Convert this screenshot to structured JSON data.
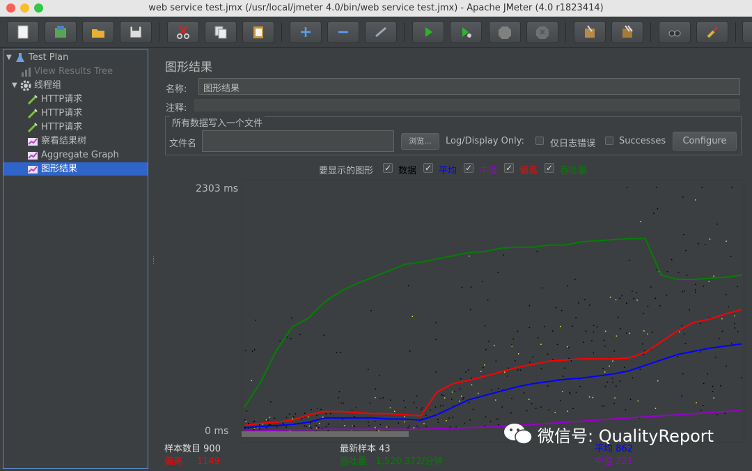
{
  "window": {
    "title": "web service test.jmx (/usr/local/jmeter 4.0/bin/web service test.jmx) - Apache JMeter (4.0 r1823414)"
  },
  "toolbar": {
    "buttons": [
      "new-icon",
      "templates-icon",
      "open-icon",
      "save-icon",
      "cut-icon",
      "copy-icon",
      "paste-icon",
      "expand-icon",
      "collapse-icon",
      "toggle-icon",
      "start-icon",
      "start-no-pause-icon",
      "stop-icon",
      "shutdown-icon",
      "clear-icon",
      "clear-all-icon",
      "search-icon",
      "reset-search-icon"
    ]
  },
  "tree": {
    "test_plan": "Test Plan",
    "view_results_tree": "View Results Tree",
    "thread_group": "线程组",
    "http1": "HTTP请求",
    "http2": "HTTP请求",
    "http3": "HTTP请求",
    "results_tree_cn": "察看结果树",
    "aggregate_graph": "Aggregate Graph",
    "graph_results": "图形结果"
  },
  "panel": {
    "title": "图形结果",
    "name_label": "名称:",
    "name_value": "图形结果",
    "comment_label": "注释:",
    "comment_value": "",
    "file_section": "所有数据写入一个文件",
    "filename_label": "文件名",
    "filename_value": "",
    "browse_label": "浏览...",
    "log_display_label": "Log/Display Only:",
    "errors_only_label": "仅日志错误",
    "successes_label": "Successes",
    "configure_label": "Configure",
    "show_label": "要显示的图形",
    "show_data": "数据",
    "show_average": "平均",
    "show_median": "中值",
    "show_deviation": "偏离",
    "show_throughput": "吞吐量",
    "colors": {
      "average": "#0000ff",
      "median": "#9900cc",
      "deviation": "#ff0000",
      "throughput": "#008000",
      "data": "#000000"
    }
  },
  "chart_data": {
    "type": "line",
    "ymax_label": "2303",
    "ymin_label": "0",
    "yunit": "ms",
    "ylim": [
      0,
      2303
    ],
    "series": [
      {
        "name": "吞吐量",
        "values": [
          250,
          480,
          780,
          1000,
          1080,
          1230,
          1330,
          1400,
          1460,
          1520,
          1580,
          1600,
          1630,
          1660,
          1690,
          1700,
          1730,
          1740,
          1740,
          1760,
          1760,
          1790,
          1800,
          1810,
          1820,
          1820,
          1480,
          1440,
          1440,
          1450,
          1460,
          1480
        ]
      },
      {
        "name": "偏离",
        "values": [
          80,
          100,
          110,
          130,
          180,
          210,
          210,
          200,
          190,
          190,
          180,
          170,
          390,
          470,
          500,
          540,
          580,
          620,
          650,
          680,
          690,
          700,
          700,
          700,
          710,
          760,
          860,
          960,
          1040,
          1070,
          1120,
          1160
        ]
      },
      {
        "name": "平均",
        "values": [
          60,
          70,
          80,
          90,
          110,
          150,
          150,
          150,
          150,
          140,
          140,
          130,
          180,
          250,
          320,
          360,
          400,
          440,
          470,
          490,
          510,
          520,
          540,
          560,
          590,
          640,
          690,
          740,
          770,
          800,
          820,
          840
        ]
      },
      {
        "name": "中值",
        "values": [
          30,
          30,
          35,
          40,
          40,
          45,
          45,
          45,
          45,
          45,
          45,
          45,
          50,
          55,
          60,
          65,
          70,
          80,
          90,
          100,
          110,
          120,
          130,
          140,
          150,
          160,
          170,
          180,
          190,
          200,
          210,
          220
        ]
      }
    ]
  },
  "stats": {
    "samples_label": "样本数目",
    "samples_value": "900",
    "latest_label": "最新样本",
    "latest_value": "43",
    "average_label": "平均",
    "average_value": "862",
    "deviation_label": "偏离",
    "deviation_value": "1149",
    "throughput_label": "吞吐量",
    "throughput_value": "1,520.372/分钟",
    "median_label": "中值",
    "median_value": "221"
  },
  "watermark": {
    "text": "微信号: QualityReport"
  }
}
